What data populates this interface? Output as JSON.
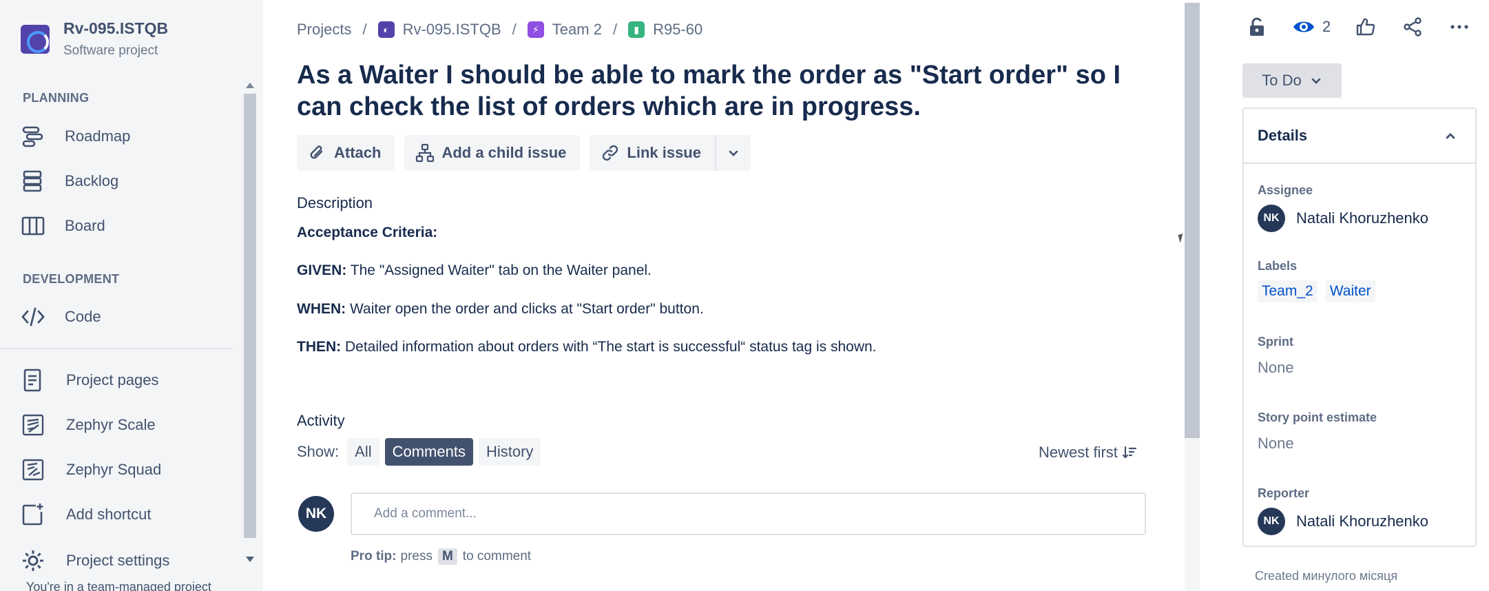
{
  "project": {
    "name": "Rv-095.ISTQB",
    "type": "Software project"
  },
  "sidebar": {
    "planning_title": "PLANNING",
    "planning_items": [
      {
        "label": "Roadmap",
        "icon": "roadmap-icon"
      },
      {
        "label": "Backlog",
        "icon": "backlog-icon"
      },
      {
        "label": "Board",
        "icon": "board-icon"
      }
    ],
    "development_title": "DEVELOPMENT",
    "development_items": [
      {
        "label": "Code",
        "icon": "code-icon"
      }
    ],
    "other_items": [
      {
        "label": "Project pages",
        "icon": "page-icon"
      },
      {
        "label": "Zephyr Scale",
        "icon": "zephyr-scale-icon"
      },
      {
        "label": "Zephyr Squad",
        "icon": "zephyr-squad-icon"
      },
      {
        "label": "Add shortcut",
        "icon": "add-shortcut-icon"
      },
      {
        "label": "Project settings",
        "icon": "gear-icon"
      }
    ],
    "footer_text": "You're in a team-managed project"
  },
  "breadcrumb": {
    "projects": "Projects",
    "project": "Rv-095.ISTQB",
    "epic": "Team 2",
    "issue": "R95-60"
  },
  "issue": {
    "title": "As a Waiter I should be able to mark the order as \"Start order\" so I can check the list of orders which are in progress."
  },
  "toolbar": {
    "attach": "Attach",
    "add_child": "Add a child issue",
    "link_issue": "Link issue"
  },
  "description": {
    "title": "Description",
    "acceptance": "Acceptance Criteria:",
    "given_label": "GIVEN:",
    "given_text": " The \"Assigned Waiter\" tab on the Waiter panel.",
    "when_label": "WHEN:",
    "when_text": " Waiter open the order and clicks at \"Start order\" button.",
    "then_label": "THEN:",
    "then_text": " Detailed information about orders with “The start is successful“ status tag is shown."
  },
  "activity": {
    "title": "Activity",
    "show_label": "Show:",
    "filters": [
      "All",
      "Comments",
      "History"
    ],
    "active_filter": "Comments",
    "sort_label": "Newest first",
    "user_initials": "NK",
    "comment_placeholder": "Add a comment...",
    "pro_tip_label": "Pro tip:",
    "pro_tip_press": "press",
    "pro_tip_key": "M",
    "pro_tip_suffix": "to comment"
  },
  "right_panel": {
    "watch_count": "2",
    "status": "To Do",
    "details_title": "Details",
    "assignee_label": "Assignee",
    "assignee_initials": "NK",
    "assignee_name": "Natali Khoruzhenko",
    "labels_label": "Labels",
    "labels": [
      "Team_2",
      "Waiter"
    ],
    "sprint_label": "Sprint",
    "sprint_value": "None",
    "story_points_label": "Story point estimate",
    "story_points_value": "None",
    "reporter_label": "Reporter",
    "reporter_initials": "NK",
    "reporter_name": "Natali Khoruzhenko",
    "created_text": "Created минулого місяця"
  },
  "colors": {
    "accent": "#0052cc",
    "sidebar_bg": "#f4f5f7",
    "text_primary": "#172b4d",
    "active_chip": "#42526e"
  }
}
